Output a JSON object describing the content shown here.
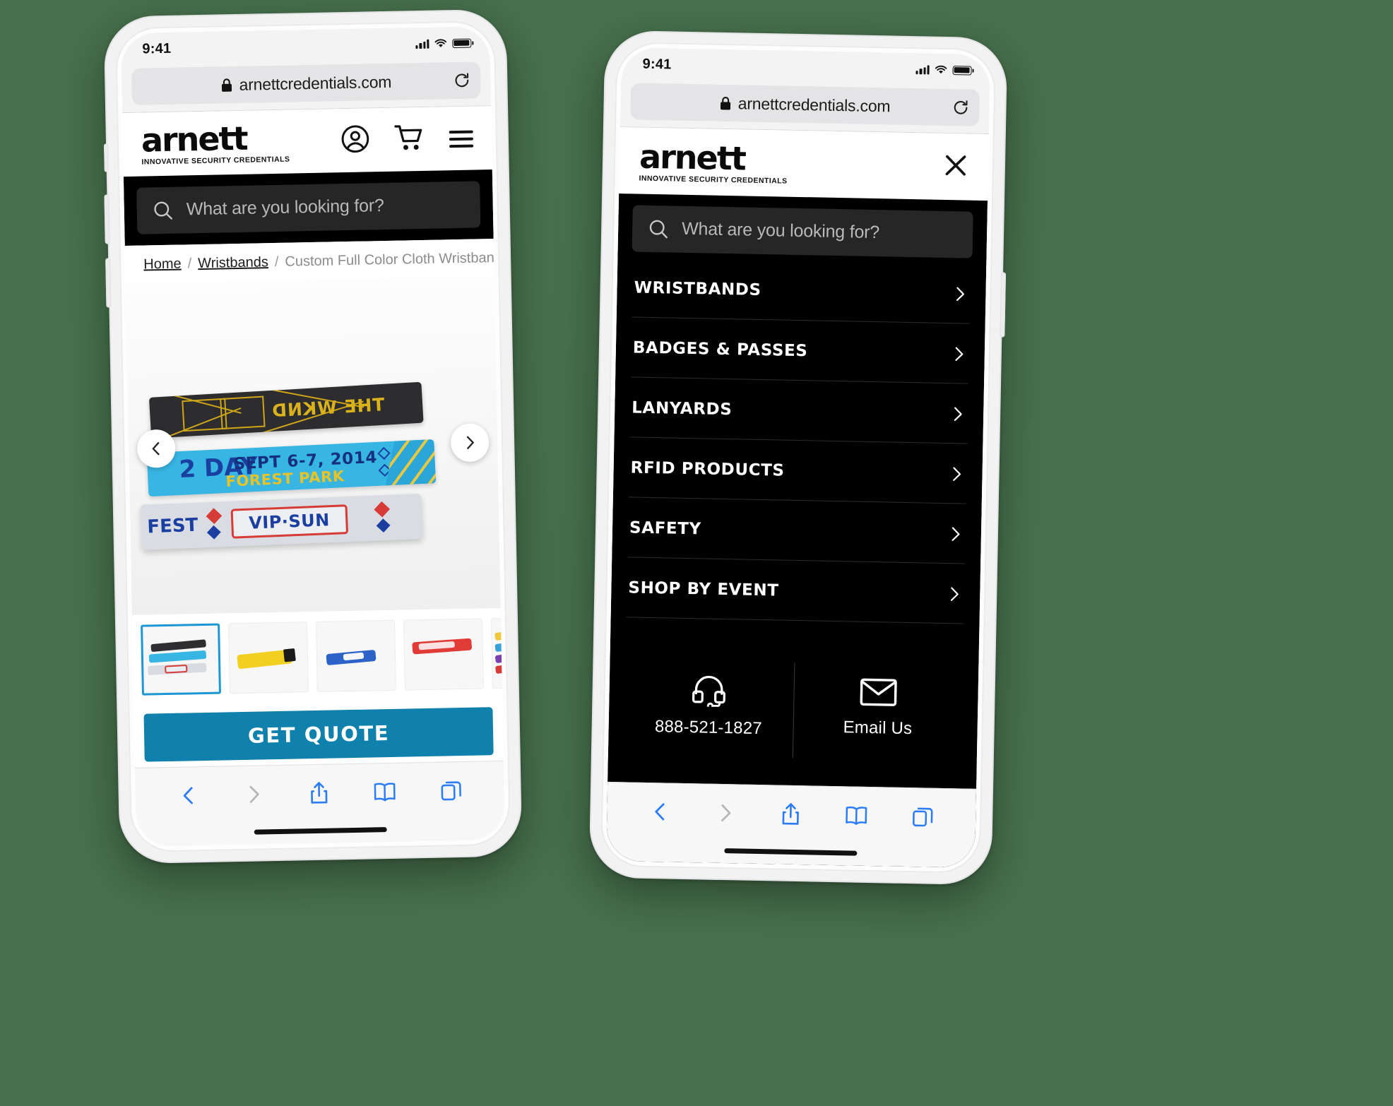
{
  "background_color": "#47704c",
  "phones": {
    "left": {
      "status": {
        "time": "9:41"
      },
      "browser": {
        "url": "arnettcredentials.com",
        "lock_icon": "lock-icon",
        "reload_icon": "reload-icon"
      },
      "site_header": {
        "logo_word": "arnett",
        "logo_tagline": "INNOVATIVE SECURITY CREDENTIALS",
        "account_icon": "account-icon",
        "cart_icon": "cart-icon",
        "menu_icon": "hamburger-icon"
      },
      "search": {
        "placeholder": "What are you looking for?",
        "icon": "search-icon"
      },
      "breadcrumb": {
        "items": [
          "Home",
          "Wristbands",
          "Custom Full Color Cloth Wristbands"
        ],
        "separator": "/"
      },
      "gallery": {
        "prev_icon": "chevron-left-icon",
        "next_icon": "chevron-right-icon",
        "band_texts": {
          "black_band": "THE WKND",
          "blue_band_date": "SEPT 6-7, 2014",
          "blue_band_place": "FOREST PARK",
          "blue_band_day": "2 DAY",
          "red_band_label": "VIP·SUN",
          "red_band_fest": "FEST"
        },
        "thumbnails": [
          {
            "name": "thumb-multicolor-stack",
            "selected": true
          },
          {
            "name": "thumb-yellow-camp",
            "selected": false
          },
          {
            "name": "thumb-blue-fest",
            "selected": false
          },
          {
            "name": "thumb-red-camp",
            "selected": false
          },
          {
            "name": "thumb-assorted-strip",
            "selected": false
          }
        ]
      },
      "cta": {
        "label": "GET QUOTE",
        "color": "#1080ad"
      },
      "safari_toolbar": {
        "back_icon": "chevron-left-icon",
        "forward_icon": "chevron-right-icon",
        "share_icon": "share-icon",
        "bookmarks_icon": "book-icon",
        "tabs_icon": "tabs-icon"
      }
    },
    "right": {
      "status": {
        "time": "9:41"
      },
      "browser": {
        "url": "arnettcredentials.com",
        "lock_icon": "lock-icon",
        "reload_icon": "reload-icon"
      },
      "menu_header": {
        "logo_word": "arnett",
        "logo_tagline": "INNOVATIVE SECURITY CREDENTIALS",
        "close_icon": "close-icon"
      },
      "search": {
        "placeholder": "What are you looking for?",
        "icon": "search-icon"
      },
      "menu_items": [
        {
          "label": "WRISTBANDS",
          "chevron": "chevron-right-icon"
        },
        {
          "label": "BADGES & PASSES",
          "chevron": "chevron-right-icon"
        },
        {
          "label": "LANYARDS",
          "chevron": "chevron-right-icon"
        },
        {
          "label": "RFID PRODUCTS",
          "chevron": "chevron-right-icon"
        },
        {
          "label": "SAFETY",
          "chevron": "chevron-right-icon"
        },
        {
          "label": "SHOP BY EVENT",
          "chevron": "chevron-right-icon"
        }
      ],
      "contact": {
        "phone_icon": "headset-icon",
        "phone": "888-521-1827",
        "email_icon": "envelope-icon",
        "email_label": "Email Us"
      },
      "safari_toolbar": {
        "back_icon": "chevron-left-icon",
        "forward_icon": "chevron-right-icon",
        "share_icon": "share-icon",
        "bookmarks_icon": "book-icon",
        "tabs_icon": "tabs-icon"
      }
    }
  }
}
